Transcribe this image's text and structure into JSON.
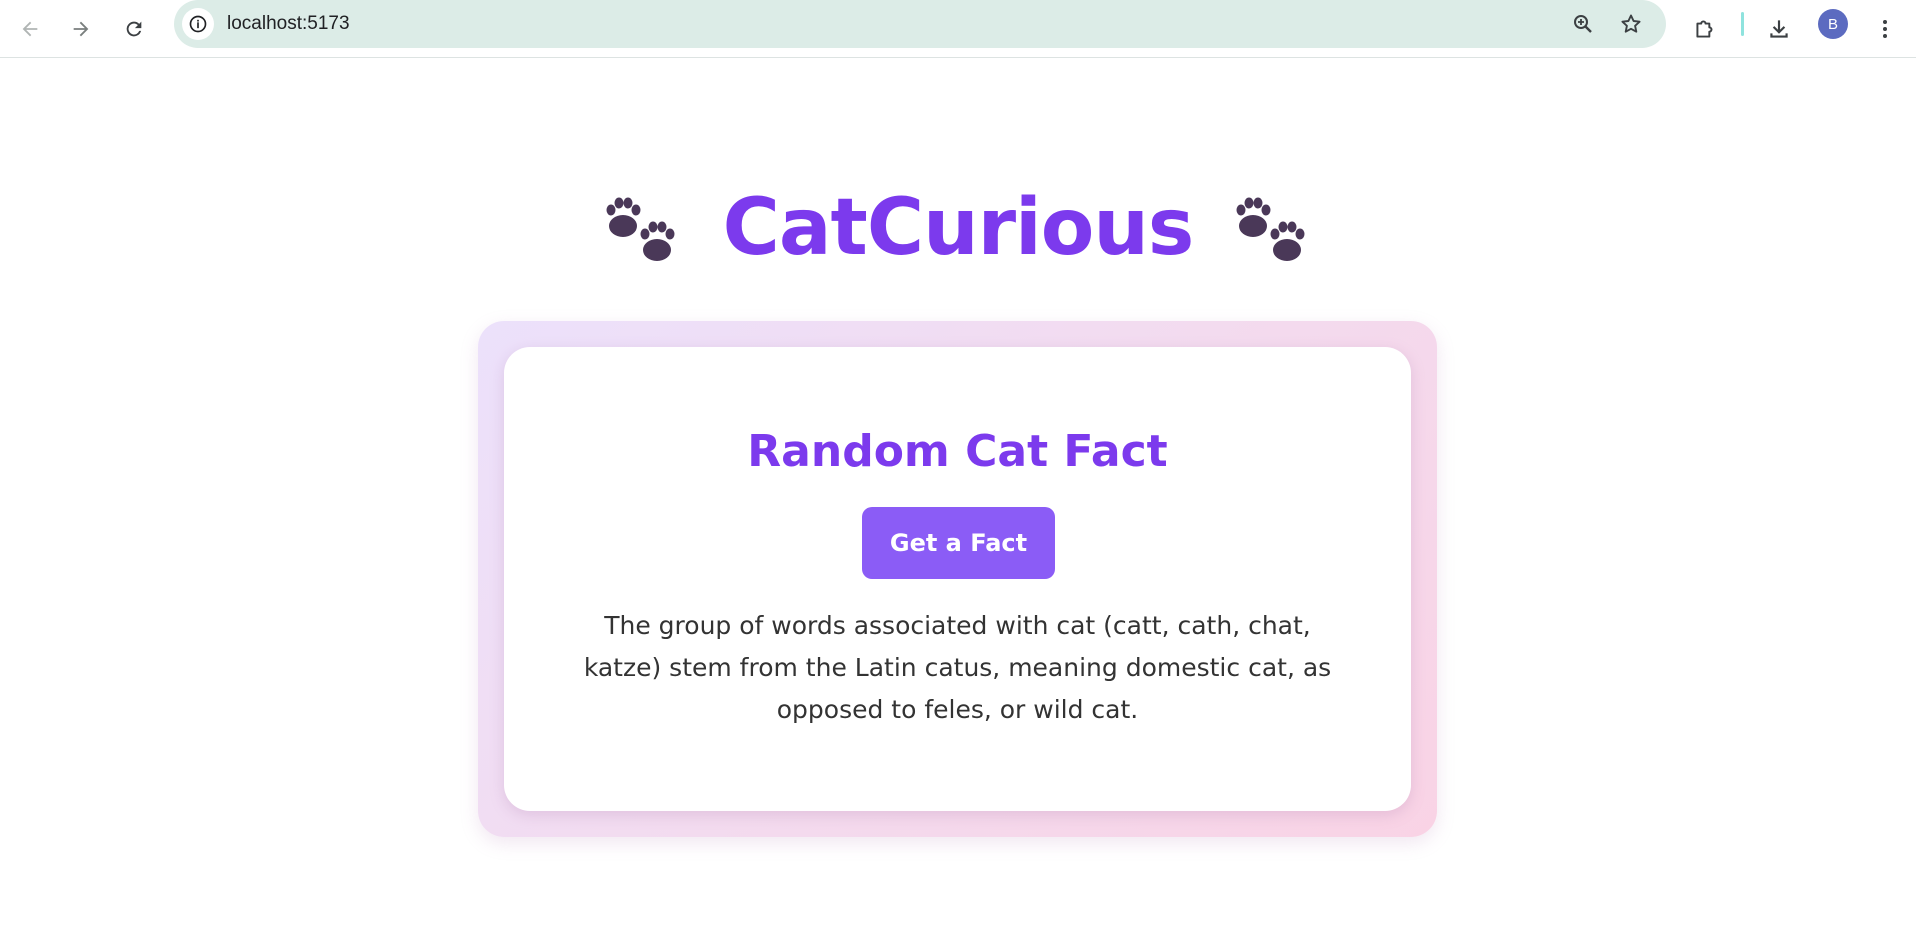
{
  "browser": {
    "url": "localhost:5173",
    "profile_initial": "B"
  },
  "header": {
    "title": "CatCurious",
    "left_icon": "paw-prints-icon",
    "right_icon": "paw-prints-icon"
  },
  "card": {
    "title": "Random Cat Fact",
    "button_label": "Get a Fact",
    "fact": "The group of words associated with cat (catt, cath, chat, katze) stem from the Latin catus, meaning domestic cat, as opposed to feles, or wild cat."
  },
  "colors": {
    "accent": "#7c3aed",
    "button": "#8b5cf6",
    "omnibox": "#dcece7"
  }
}
